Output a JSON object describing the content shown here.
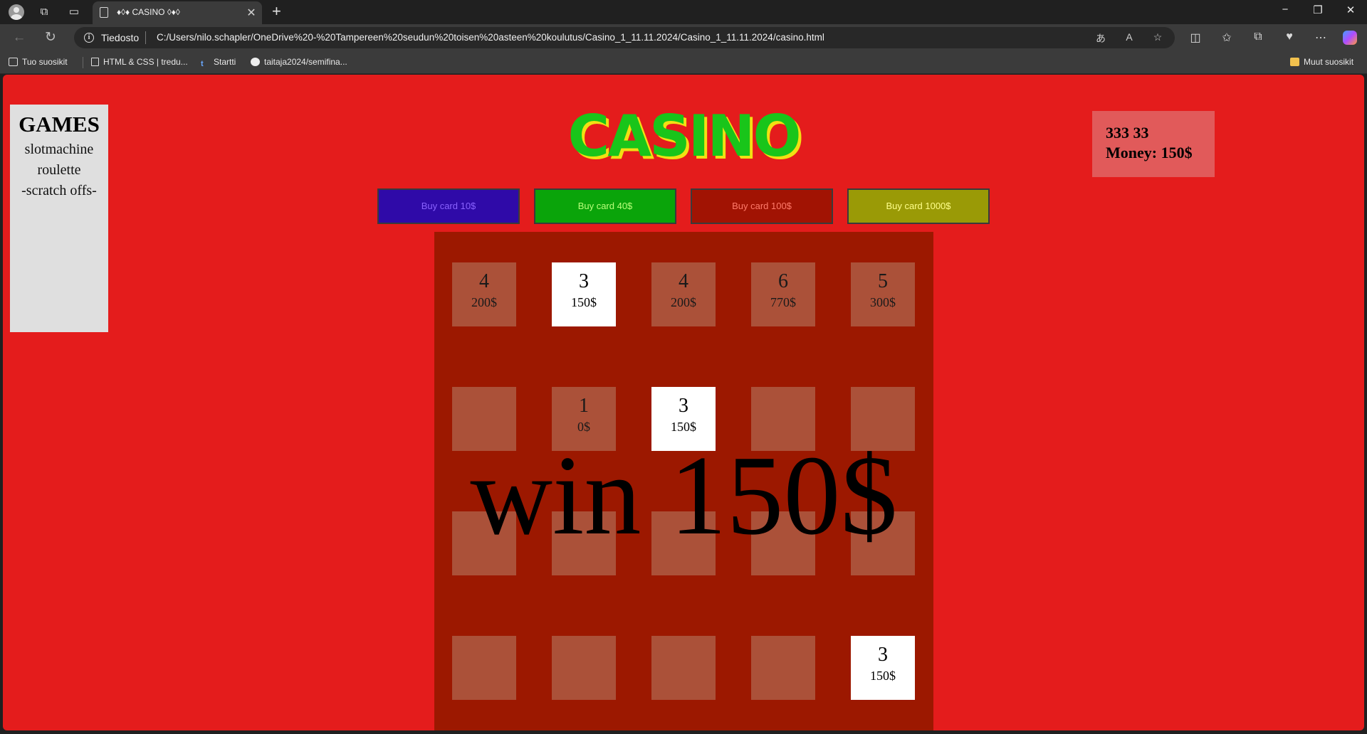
{
  "browser": {
    "tab_title": "♦◊♦ CASINO ◊♦◊",
    "scheme_label": "Tiedosto",
    "url": "C:/Users/nilo.schapler/OneDrive%20-%20Tampereen%20seudun%20toisen%20asteen%20koulutus/Casino_1_11.11.2024/Casino_1_11.11.2024/casino.html",
    "bookmarks": [
      "Tuo suosikit",
      "HTML & CSS | tredu...",
      "Startti",
      "taitaja2024/semifina..."
    ],
    "other_bookmarks": "Muut suosikit"
  },
  "page": {
    "title": "CASINO",
    "games": {
      "heading": "GAMES",
      "items": [
        "slotmachine",
        "roulette",
        "-scratch offs-"
      ]
    },
    "money": {
      "line1": "333 33",
      "line2": "Money: 150$"
    },
    "buy_buttons": [
      {
        "label": "Buy card 10$",
        "bg": "#2f0aa8",
        "fg": "#8a62ff"
      },
      {
        "label": "Buy card 40$",
        "bg": "#0aa40a",
        "fg": "#b8ff7a"
      },
      {
        "label": "Buy card 100$",
        "bg": "#a11303",
        "fg": "#ff7a6a"
      },
      {
        "label": "Buy card 1000$",
        "bg": "#9a9a06",
        "fg": "#ffff8a"
      }
    ],
    "grid": [
      [
        {
          "n": "4",
          "p": "200$",
          "r": false
        },
        {
          "n": "3",
          "p": "150$",
          "r": true
        },
        {
          "n": "4",
          "p": "200$",
          "r": false
        },
        {
          "n": "6",
          "p": "770$",
          "r": false
        },
        {
          "n": "5",
          "p": "300$",
          "r": false
        }
      ],
      [
        {
          "n": "",
          "p": "",
          "r": false
        },
        {
          "n": "1",
          "p": "0$",
          "r": false
        },
        {
          "n": "3",
          "p": "150$",
          "r": true
        },
        {
          "n": "",
          "p": "",
          "r": false
        },
        {
          "n": "",
          "p": "",
          "r": false
        }
      ],
      [
        {
          "n": "",
          "p": "",
          "r": false
        },
        {
          "n": "",
          "p": "",
          "r": false
        },
        {
          "n": "",
          "p": "",
          "r": false
        },
        {
          "n": "",
          "p": "",
          "r": false
        },
        {
          "n": "",
          "p": "",
          "r": false
        }
      ],
      [
        {
          "n": "",
          "p": "",
          "r": false
        },
        {
          "n": "",
          "p": "",
          "r": false
        },
        {
          "n": "",
          "p": "",
          "r": false
        },
        {
          "n": "",
          "p": "",
          "r": false
        },
        {
          "n": "3",
          "p": "150$",
          "r": true
        }
      ]
    ],
    "win_message": "win 150$"
  }
}
